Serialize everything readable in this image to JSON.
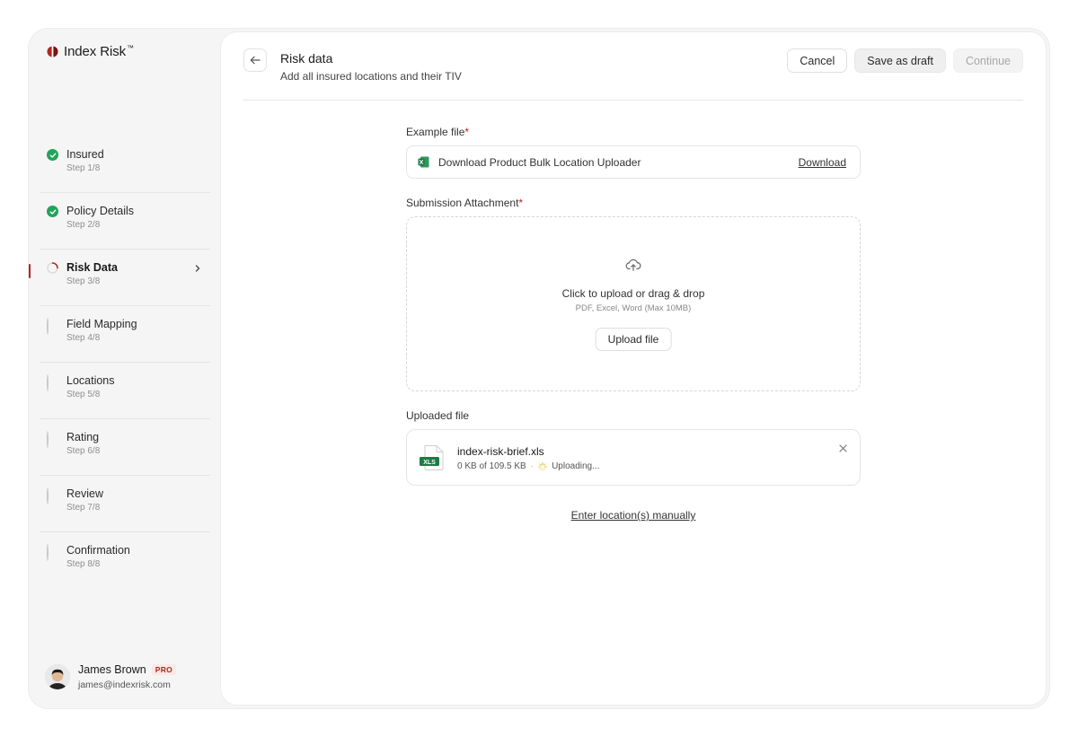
{
  "brand": {
    "name": "Index Risk",
    "tm": "™",
    "accent": "#b3261e"
  },
  "steps": [
    {
      "title": "Insured",
      "sub": "Step 1/8",
      "status": "done"
    },
    {
      "title": "Policy Details",
      "sub": "Step 2/8",
      "status": "done"
    },
    {
      "title": "Risk Data",
      "sub": "Step 3/8",
      "status": "active"
    },
    {
      "title": "Field Mapping",
      "sub": "Step 4/8",
      "status": "todo"
    },
    {
      "title": "Locations",
      "sub": "Step 5/8",
      "status": "todo"
    },
    {
      "title": "Rating",
      "sub": "Step 6/8",
      "status": "todo"
    },
    {
      "title": "Review",
      "sub": "Step 7/8",
      "status": "todo"
    },
    {
      "title": "Confirmation",
      "sub": "Step 8/8",
      "status": "todo"
    }
  ],
  "user": {
    "name": "James Brown",
    "badge": "PRO",
    "email": "james@indexrisk.com"
  },
  "header": {
    "back_icon": "arrow-left-icon",
    "title": "Risk data",
    "subtitle": "Add all insured locations and their TIV",
    "cancel_label": "Cancel",
    "draft_label": "Save as draft",
    "continue_label": "Continue"
  },
  "example_file": {
    "label": "Example file",
    "required_mark": "*",
    "name": "Download Product Bulk Location Uploader",
    "download_label": "Download"
  },
  "attachment": {
    "label": "Submission Attachment",
    "required_mark": "*",
    "drop_title": "Click to upload or drag & drop",
    "drop_hint": "PDF, Excel, Word (Max 10MB)",
    "upload_label": "Upload file"
  },
  "uploaded": {
    "label": "Uploaded file",
    "file_name": "index-risk-brief.xls",
    "file_badge": "XLS",
    "progress_text": "0 KB of 109.5 KB",
    "separator": "·",
    "status": "Uploading..."
  },
  "manual_link": "Enter location(s) manually",
  "colors": {
    "success": "#22a35b",
    "excel": "#1f7a45",
    "accent": "#b3261e"
  }
}
